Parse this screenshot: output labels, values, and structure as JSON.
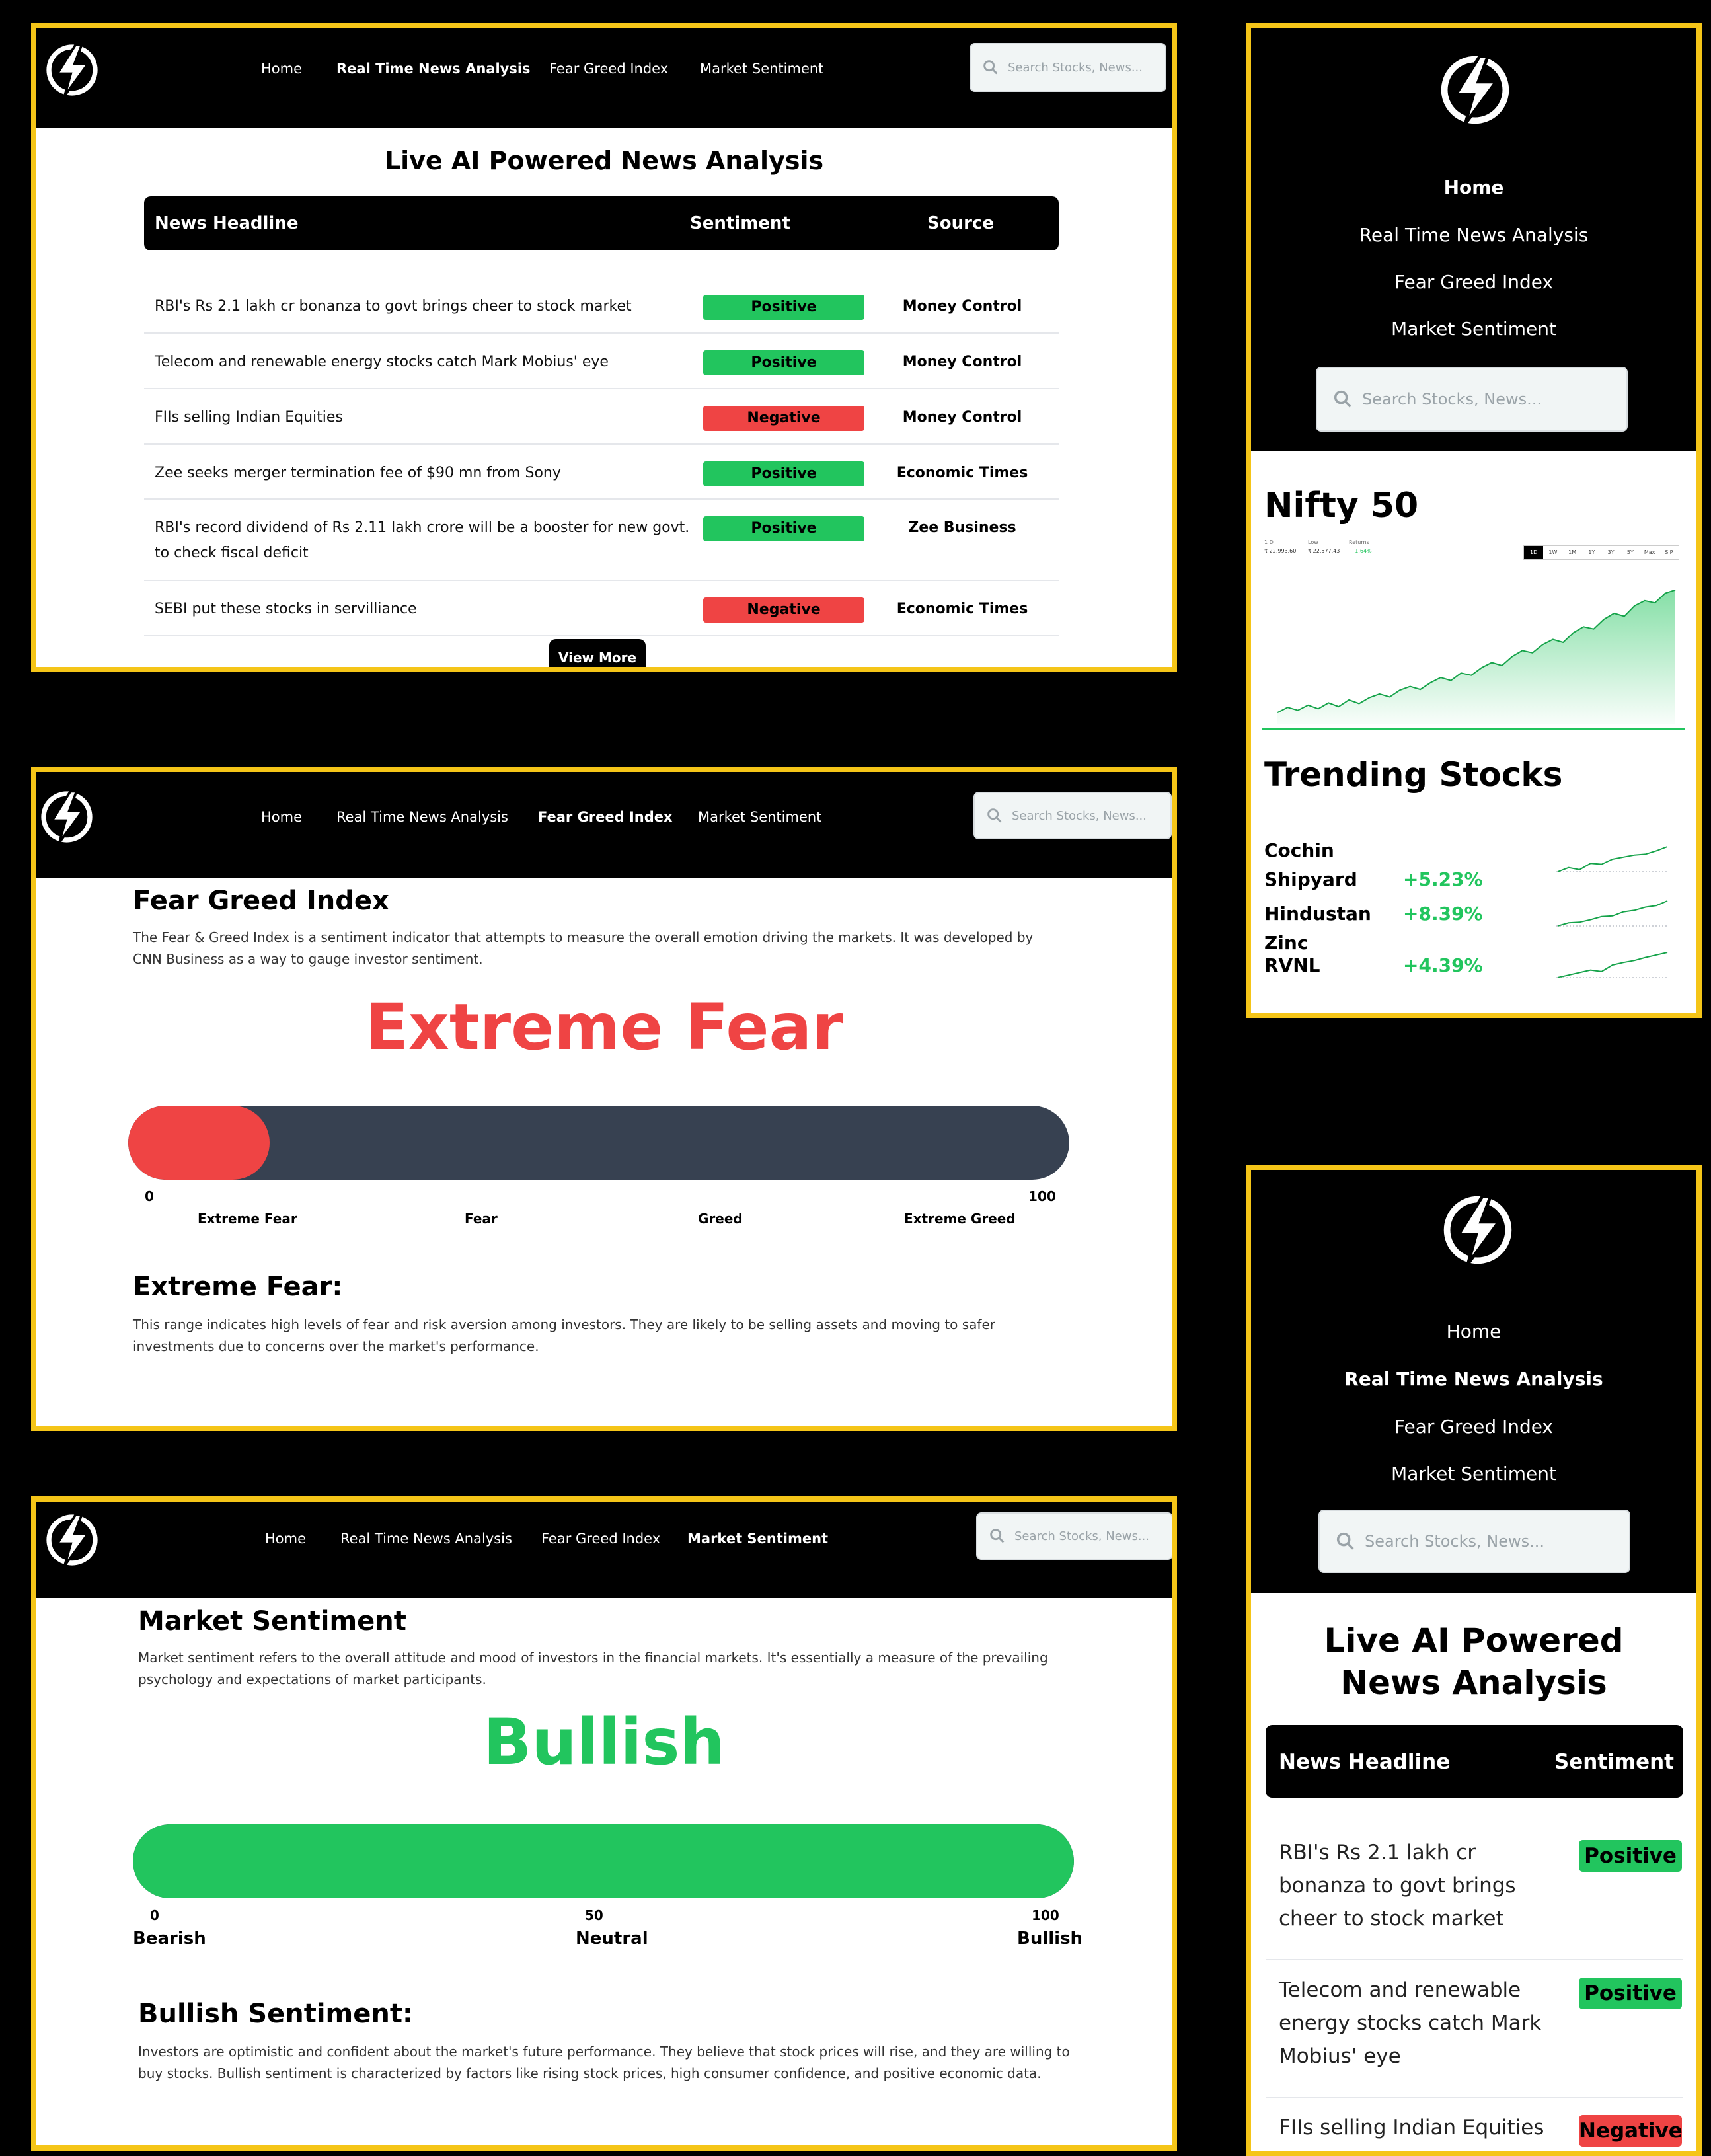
{
  "colors": {
    "accent_border": "#f5c518",
    "positive": "#22c55e",
    "negative": "#ef4444",
    "dark_bar": "#374151",
    "nav_bg": "#000000"
  },
  "nav": {
    "home": "Home",
    "news": "Real Time News Analysis",
    "fear_greed": "Fear Greed Index",
    "sentiment": "Market Sentiment",
    "search_placeholder": "Search Stocks, News..."
  },
  "news_panel": {
    "title": "Live AI Powered News Analysis",
    "columns": [
      "News Headline",
      "Sentiment",
      "Source"
    ],
    "rows": [
      {
        "headline": "RBI's Rs 2.1 lakh cr bonanza to govt brings cheer to stock market",
        "sentiment": "Positive",
        "source": "Money Control"
      },
      {
        "headline": "Telecom and renewable energy stocks catch Mark Mobius' eye",
        "sentiment": "Positive",
        "source": "Money Control"
      },
      {
        "headline": "FIIs selling Indian Equities",
        "sentiment": "Negative",
        "source": "Money Control"
      },
      {
        "headline": "Zee seeks merger termination fee of $90 mn from Sony",
        "sentiment": "Positive",
        "source": "Economic Times"
      },
      {
        "headline": "RBI's record dividend of Rs 2.11 lakh crore will be a booster for new govt. to check fiscal deficit",
        "sentiment": "Positive",
        "source": "Zee Business"
      },
      {
        "headline": "SEBI put these stocks in servilliance",
        "sentiment": "Negative",
        "source": "Economic Times"
      }
    ],
    "view_more": "View More"
  },
  "fear_greed_panel": {
    "heading": "Fear Greed Index",
    "description": "The Fear & Greed Index is a sentiment indicator that attempts to measure the overall emotion driving the markets. It was developed by CNN Business as a way to gauge investor sentiment.",
    "status": "Extreme Fear",
    "level_fraction": 0.15,
    "scale_min": "0",
    "scale_max": "100",
    "zones": [
      "Extreme Fear",
      "Fear",
      "Greed",
      "Extreme Greed"
    ],
    "detail_heading": "Extreme Fear:",
    "detail_text": "This range indicates high levels of fear and risk aversion among investors. They are likely to be selling assets and moving to safer investments due to concerns over the market's performance."
  },
  "market_sentiment_panel": {
    "heading": "Market Sentiment",
    "description": "Market sentiment refers to the overall attitude and mood of investors in the financial markets. It's essentially a measure of the prevailing psychology and expectations of market participants.",
    "status": "Bullish",
    "level_fraction": 1.0,
    "scale": [
      {
        "value": "0",
        "label": "Bearish"
      },
      {
        "value": "50",
        "label": "Neutral"
      },
      {
        "value": "100",
        "label": "Bullish"
      }
    ],
    "detail_heading": "Bullish Sentiment:",
    "detail_text": "Investors are optimistic and confident about the market's future performance. They believe that stock prices will rise, and they are willing to buy stocks. Bullish sentiment is characterized by factors like rising stock prices, high consumer confidence, and positive economic data."
  },
  "mobile_dashboard": {
    "nifty_title": "Nifty 50",
    "nifty_stats": [
      "1 D",
      "Low",
      "Returns"
    ],
    "nifty_values": [
      "₹ 22,993.60",
      "₹ 22,577.43",
      "+ 1.64%"
    ],
    "range_tabs": [
      "1D",
      "1W",
      "1M",
      "1Y",
      "3Y",
      "5Y",
      "Max",
      "SIP"
    ],
    "chart_data": {
      "type": "area",
      "y": [
        21350,
        21420,
        21380,
        21450,
        21400,
        21480,
        21430,
        21520,
        21470,
        21550,
        21600,
        21560,
        21650,
        21700,
        21660,
        21750,
        21820,
        21780,
        21880,
        21850,
        21950,
        22020,
        21980,
        22100,
        22180,
        22150,
        22260,
        22330,
        22290,
        22420,
        22500,
        22470,
        22600,
        22680,
        22640,
        22780,
        22850,
        22820,
        22950,
        22993
      ],
      "ylim": [
        21200,
        23150
      ]
    },
    "trending_title": "Trending Stocks",
    "trending": [
      {
        "name": "Cochin Shipyard",
        "change": "+5.23%",
        "spark": [
          3,
          4,
          3.5,
          5,
          4.8,
          6,
          6.5,
          7,
          7.2,
          8,
          9
        ]
      },
      {
        "name": "Hindustan Zinc",
        "change": "+8.39%",
        "spark": [
          2,
          3,
          3.2,
          4,
          5,
          5.2,
          6.5,
          7,
          8,
          8.5,
          10
        ]
      },
      {
        "name": "RVNL",
        "change": "+4.39%",
        "spark": [
          3,
          3.5,
          4,
          4.5,
          4.2,
          5.5,
          6,
          6.4,
          7,
          7.5,
          8
        ]
      }
    ]
  },
  "mobile_news": {
    "title": "Live AI Powered News Analysis",
    "columns": [
      "News Headline",
      "Sentiment"
    ]
  }
}
